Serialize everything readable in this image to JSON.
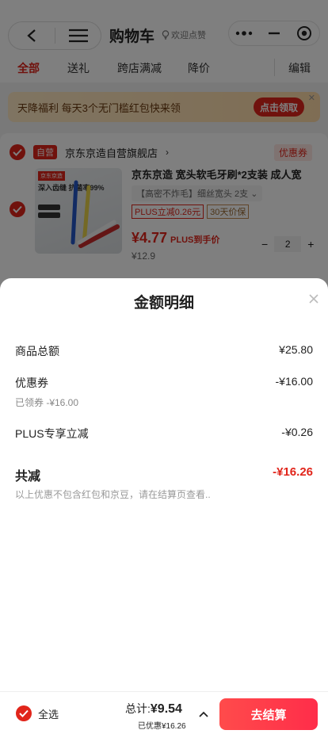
{
  "nav": {
    "title": "购物车",
    "subtitle": "欢迎点赞"
  },
  "tabs": [
    "全部",
    "送礼",
    "跨店满减",
    "降价"
  ],
  "edit_label": "编辑",
  "banner": {
    "text": "天降福利 每天3个无门槛红包快来领",
    "button": "点击领取"
  },
  "store": {
    "tag": "自营",
    "name": "京东京造自营旗舰店",
    "coupon": "优惠券"
  },
  "item": {
    "image_brand": "京东京造",
    "image_text": "深入齿缝 抗菌率99%",
    "title": "京东京造 宽头软毛牙刷*2支装 成人宽",
    "spec": "【高密不炸毛】细丝宽头 2支",
    "tag_plus": "PLUS立减0.26元",
    "tag_guarantee": "30天价保",
    "price": "¥4.77",
    "price_note": "PLUS到手价",
    "original_price": "¥12.9",
    "quantity": "2"
  },
  "sheet": {
    "title": "金额明细",
    "rows": [
      {
        "label": "商品总额",
        "value": "¥25.80"
      },
      {
        "label": "优惠券",
        "value": "-¥16.00",
        "sub": "已领券 -¥16.00"
      },
      {
        "label": "PLUS专享立减",
        "value": "-¥0.26"
      }
    ],
    "total_label": "共减",
    "total_value": "-¥16.26",
    "note": "以上优惠不包含红包和京豆，请在结算页查看.."
  },
  "bottom": {
    "select_all": "全选",
    "sum_label": "总计:",
    "sum_value": "¥9.54",
    "saved": "已优惠¥16.26",
    "checkout": "去结算"
  },
  "colors": {
    "accent": "#e1251b",
    "checkout_gradient_start": "#ff4b4b",
    "checkout_gradient_end": "#ff2d4a"
  }
}
